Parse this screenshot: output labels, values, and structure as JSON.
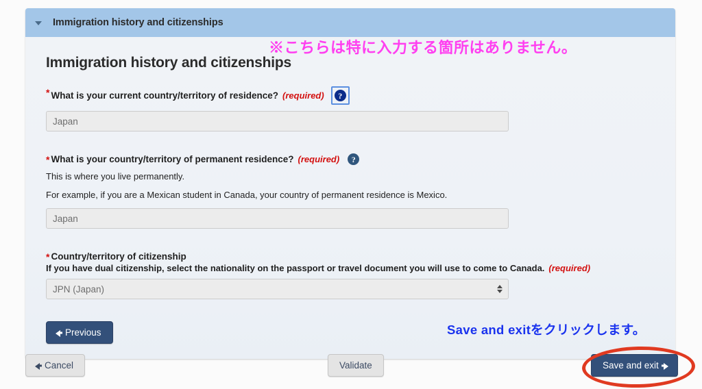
{
  "panel": {
    "header_title": "Immigration history and citizenships",
    "caret_icon": "chevron-down-icon",
    "form_heading": "Immigration history and citizenships"
  },
  "questions": [
    {
      "asterisk": "*",
      "label": "What is your current country/territory of residence?",
      "required_tag": "(required)",
      "help_icon": "question-mark-help-icon",
      "value": "Japan"
    },
    {
      "asterisk": "*",
      "label": "What is your country/territory of permanent residence?",
      "required_tag": "(required)",
      "help_icon": "question-mark-help-icon",
      "desc1": "This is where you live permanently.",
      "desc2": "For example, if you are a Mexican student in Canada, your country of permanent residence is Mexico.",
      "value": "Japan"
    },
    {
      "asterisk": "*",
      "label": "Country/territory of citizenship",
      "sub_label": "If you have dual citizenship, select the nationality on the passport or travel document you will use to come to Canada.",
      "required_tag": "(required)",
      "value": "JPN (Japan)"
    }
  ],
  "buttons": {
    "previous": "Previous",
    "cancel": "Cancel",
    "validate": "Validate",
    "save_and_exit": "Save and exit"
  },
  "annotations": {
    "pink_note": "※こちらは特に入力する箇所はありません。",
    "blue_note": "Save and exitをクリックします。",
    "highlight_shape": "red-ellipse-highlight"
  },
  "colors": {
    "panel_header": "#a3c6e8",
    "required_red": "#d3100f",
    "button_dark": "#33507a",
    "annotation_pink": "#ff3ff0",
    "annotation_blue": "#1a33ee",
    "highlight_red": "#e03a21"
  }
}
